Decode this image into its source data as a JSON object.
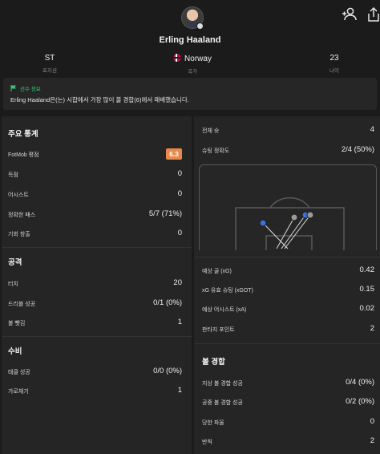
{
  "player": {
    "name": "Erling Haaland",
    "position_value": "ST",
    "position_label": "포지션",
    "country_value": "Norway",
    "country_label": "국가",
    "age_value": "23",
    "age_label": "나이"
  },
  "info": {
    "heading": "선수 정보",
    "text": "Erling Haaland은(는) 시합에서 가장 많이 볼 경합(6)에서 패배했습니다."
  },
  "left": {
    "top_stats": {
      "title": "주요 통계",
      "rows": [
        {
          "label": "FotMob 평점",
          "value": "6.3"
        },
        {
          "label": "득점",
          "value": "0"
        },
        {
          "label": "어시스트",
          "value": "0"
        },
        {
          "label": "정확한 패스",
          "value": "5/7 (71%)"
        },
        {
          "label": "기회 창출",
          "value": "0"
        }
      ]
    },
    "attack": {
      "title": "공격",
      "rows": [
        {
          "label": "터치",
          "value": "20"
        },
        {
          "label": "드리블 성공",
          "value": "0/1 (0%)"
        },
        {
          "label": "볼 뺏김",
          "value": "1"
        }
      ]
    },
    "defence": {
      "title": "수비",
      "rows": [
        {
          "label": "태클 성공",
          "value": "0/0 (0%)"
        },
        {
          "label": "가로채기",
          "value": "1"
        }
      ]
    }
  },
  "right": {
    "shots": {
      "rows": [
        {
          "label": "전체 슛",
          "value": "4"
        },
        {
          "label": "슈팅 정확도",
          "value": "2/4 (50%)"
        }
      ]
    },
    "xg": {
      "rows": [
        {
          "label": "예상 골 (xG)",
          "value": "0.42"
        },
        {
          "label": "xG 유효 슈팅 (xGOT)",
          "value": "0.15"
        },
        {
          "label": "예상 어시스트 (xA)",
          "value": "0.02"
        },
        {
          "label": "판타지 포인트",
          "value": "2"
        }
      ]
    },
    "duels": {
      "title": "볼 경합",
      "rows": [
        {
          "label": "지상 볼 경합 성공",
          "value": "0/4 (0%)"
        },
        {
          "label": "공중 볼 경합 성공",
          "value": "0/2 (0%)"
        },
        {
          "label": "당한 파울",
          "value": "0"
        },
        {
          "label": "반칙",
          "value": "2"
        }
      ]
    }
  },
  "colors": {
    "rating": "#e8894a",
    "info_heading": "#3ec47a",
    "shot_on_target": "#3d6fd6",
    "shot_off_target": "#9a9a9a"
  }
}
